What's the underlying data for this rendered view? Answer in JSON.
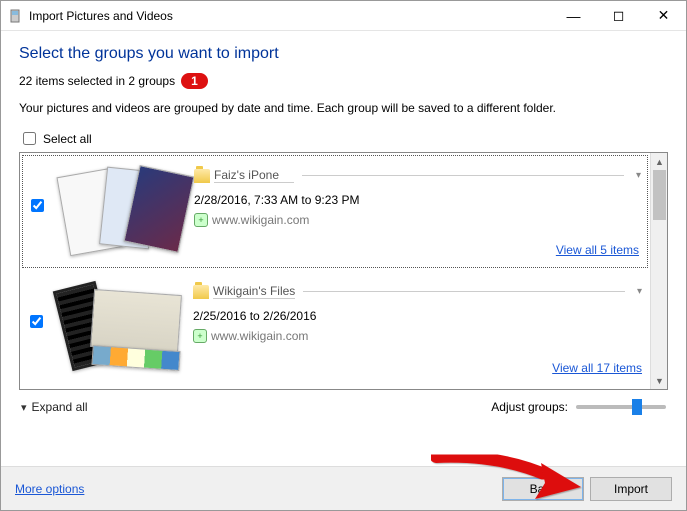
{
  "window": {
    "title": "Import Pictures and Videos",
    "minimize": "—",
    "maximize": "◻",
    "close": "✕"
  },
  "heading": "Select the groups you want to import",
  "status": "22 items selected in 2 groups",
  "annotation_badge": "1",
  "description": "Your pictures and videos are grouped by date and time. Each group will be saved to a different folder.",
  "select_all_label": "Select all",
  "groups": [
    {
      "name": "Faiz's iPone",
      "date_range": "2/28/2016, 7:33 AM to 9:23 PM",
      "tag": "www.wikigain.com",
      "view_link": "View all 5 items",
      "checked": true
    },
    {
      "name": "Wikigain's Files",
      "date_range": "2/25/2016 to 2/26/2016",
      "tag": "www.wikigain.com",
      "view_link": "View all 17 items",
      "checked": true
    }
  ],
  "expand_all": "Expand all",
  "adjust_label": "Adjust groups:",
  "footer": {
    "more_options": "More options",
    "back": "Back",
    "import": "Import"
  }
}
